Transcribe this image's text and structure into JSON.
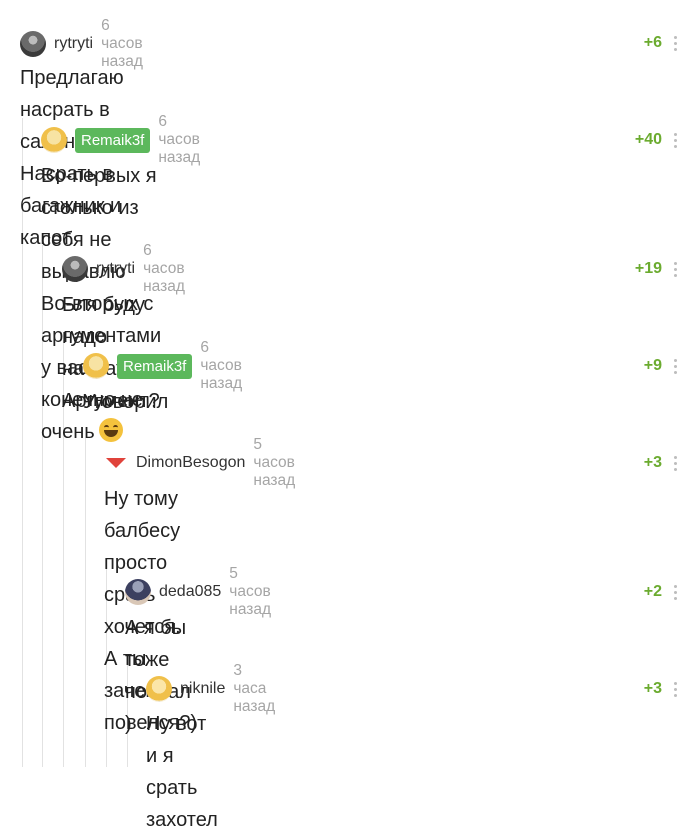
{
  "comments": [
    {
      "user": "rytryti",
      "time": "6 часов назад",
      "rating": "+6",
      "text": "Предлагаю насрать в салон. Насрать в багажник и капот."
    },
    {
      "user": "Remaik3f",
      "time": "6 часов назад",
      "rating": "+40",
      "text": "Во-первых я столько из себя не выдавлю\nВо-вторых с аргументами у вас конечно не очень",
      "emoji": "grinning-face-emoji"
    },
    {
      "user": "rytryti",
      "time": "6 часов назад",
      "rating": "+19",
      "text": "Бля буду надо насрать. Аргумент?"
    },
    {
      "user": "Remaik3f",
      "time": "6 часов назад",
      "rating": "+9",
      "text": "Уговорил"
    },
    {
      "user": "DimonBesogon",
      "time": "5 часов назад",
      "rating": "+3",
      "text": "Ну тому балбесу просто срать хочется. А ты зачем\nповелся?)"
    },
    {
      "user": "deda085",
      "time": "5 часов назад",
      "rating": "+2",
      "text": "А я бы тоже посрал )"
    },
    {
      "user": "niknile",
      "time": "3 часа назад",
      "rating": "+3",
      "text": "Ну вот и я срать захотел"
    }
  ],
  "colors": {
    "badge": "#5cb85c",
    "rating": "#6bab2f",
    "time": "#a5a5a5",
    "thread_line": "#e2e2e2",
    "dimon_triangle": "#e0433b"
  }
}
